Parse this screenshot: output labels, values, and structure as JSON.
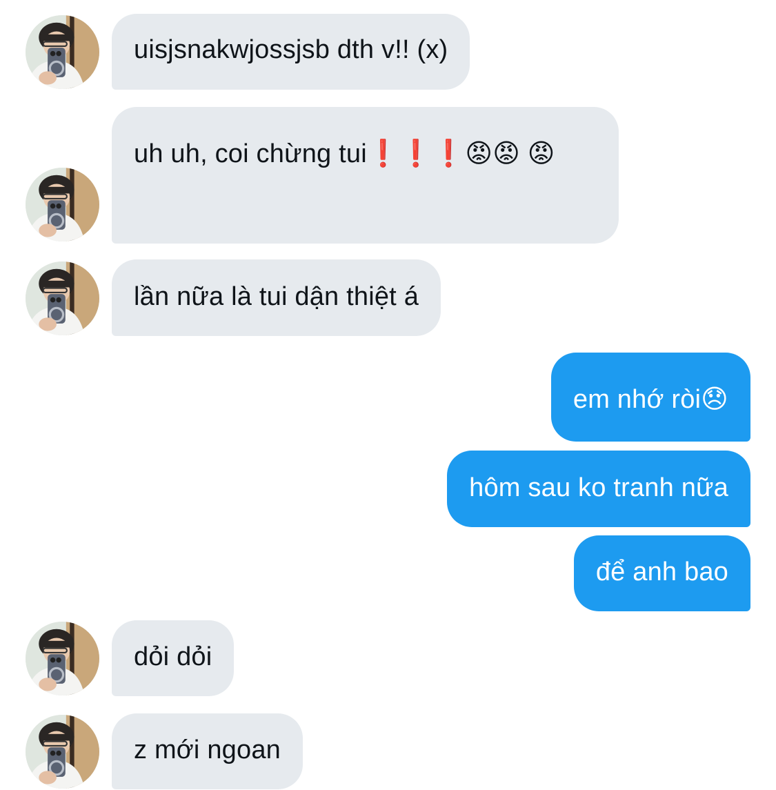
{
  "conversation": {
    "messages": [
      {
        "direction": "incoming",
        "text": "uisjsnakwjossjsb dth v!! (x)"
      },
      {
        "direction": "incoming",
        "text": "uh uh, coi chừng tui❗❗❗😡😡 😡"
      },
      {
        "direction": "incoming",
        "text": "lần nữa là tui dận thiệt á"
      },
      {
        "direction": "outgoing",
        "text": "em nhớ ròi😞"
      },
      {
        "direction": "outgoing",
        "text": "hôm sau ko tranh nữa"
      },
      {
        "direction": "outgoing",
        "text": "để anh bao"
      },
      {
        "direction": "incoming",
        "text": "dỏi dỏi"
      },
      {
        "direction": "incoming",
        "text": "z mới ngoan"
      }
    ]
  },
  "colors": {
    "incoming_bubble": "#e6eaee",
    "outgoing_bubble": "#1d9bf0",
    "incoming_text": "#0f1419",
    "outgoing_text": "#ffffff"
  }
}
